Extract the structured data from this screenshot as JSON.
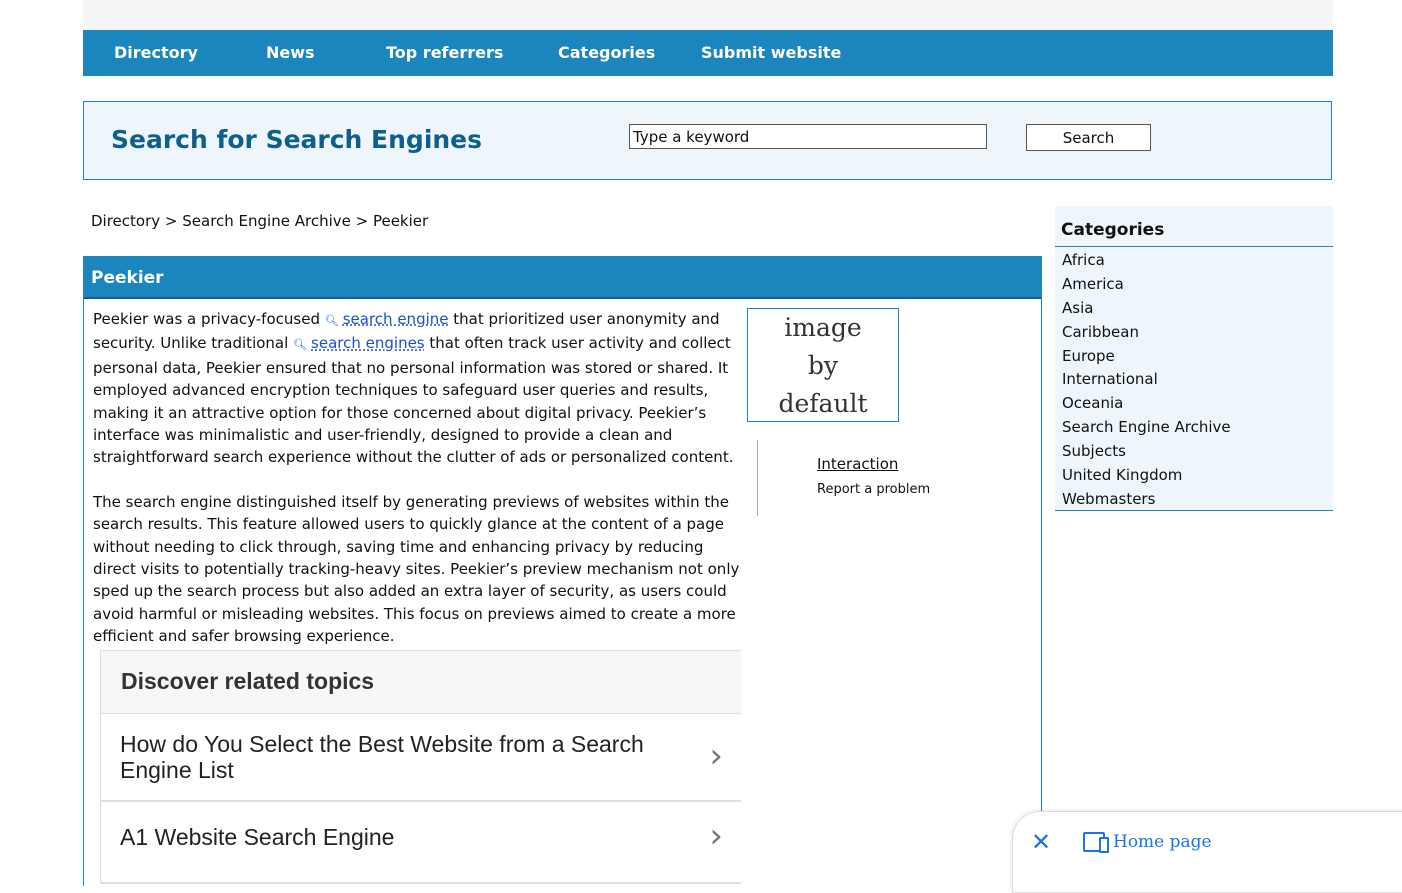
{
  "nav": {
    "items": [
      {
        "label": "Directory"
      },
      {
        "label": "News"
      },
      {
        "label": "Top referrers"
      },
      {
        "label": "Categories"
      },
      {
        "label": "Submit website"
      }
    ]
  },
  "header": {
    "title": "Search for Search Engines",
    "search_value": "Type a keyword",
    "search_button": "Search"
  },
  "breadcrumb": {
    "items": [
      "Directory",
      "Search Engine Archive",
      "Peekier"
    ],
    "separator": " > "
  },
  "article": {
    "title": "Peekier",
    "p1_a": "Peekier was a privacy-focused ",
    "link1": "search engine",
    "p1_b": " that prioritized user anonymity and security. Unlike traditional ",
    "link2": "search engines",
    "p1_c": " that often track user activity and collect personal data, Peekier ensured that no personal information was stored or shared. It employed advanced encryption techniques to safeguard user queries and results, making it an attractive option for those concerned about digital privacy. Peekier’s interface was minimalistic and user-friendly, designed to provide a clean and straightforward search experience without the clutter of ads or personalized content.",
    "p2": "The search engine distinguished itself by generating previews of websites within the search results. This feature allowed users to quickly glance at the content of a page without needing to click through, saving time and enhancing privacy by reducing direct visits to potentially tracking-heavy sites. Peekier’s preview mechanism not only sped up the search process but also added an extra layer of security, as users could avoid harmful or misleading websites. This focus on previews aimed to create a more efficient and safer browsing experience.",
    "image_text": [
      "image",
      "by",
      "default"
    ]
  },
  "interaction": {
    "title": "Interaction",
    "report": "Report a problem"
  },
  "related": {
    "heading": "Discover related topics",
    "items": [
      {
        "label": "How do You Select the Best Website from a Search Engine List"
      },
      {
        "label": "A1 Website Search Engine"
      }
    ],
    "chevron": "›"
  },
  "sidebar": {
    "title": "Categories",
    "items": [
      "Africa",
      "America",
      "Asia",
      "Caribbean",
      "Europe",
      "International",
      "Oceania",
      "Search Engine Archive",
      "Subjects",
      "United Kingdom",
      "Webmasters"
    ]
  },
  "toast": {
    "close": "✕",
    "label": "Home page"
  }
}
